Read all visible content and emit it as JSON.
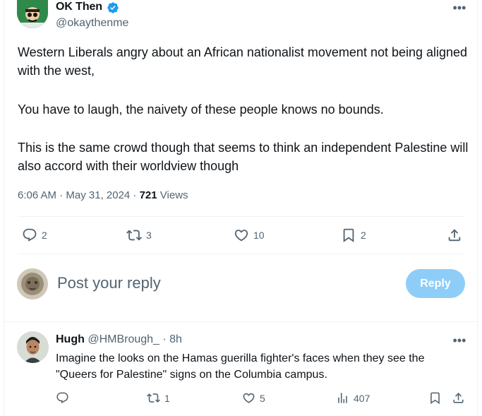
{
  "tweet": {
    "author_name": "OK Then",
    "author_handle": "@okaythenme",
    "paragraphs": [
      "Western Liberals angry about an African nationalist movement not being aligned with the west,",
      "You have to laugh, the naivety of these people knows no bounds.",
      "This is the same crowd though that seems to think an independent Palestine will also accord with their worldview though"
    ],
    "timestamp": "6:06 AM · May 31, 2024 · ",
    "views_count": "721",
    "views_label": " Views",
    "stats": {
      "replies": "2",
      "reposts": "3",
      "likes": "10",
      "bookmarks": "2"
    }
  },
  "reply_composer": {
    "placeholder": "Post your reply",
    "button_label": "Reply"
  },
  "reply": {
    "author_name": "Hugh",
    "author_handle": " @HMBrough_",
    "time": " · 8h",
    "text": "Imagine the looks on the Hamas guerilla fighter's faces when they see the \"Queers for Palestine\" signs on the Columbia campus.",
    "stats": {
      "replies": "",
      "reposts": "1",
      "likes": "5",
      "views": "407"
    }
  },
  "colors": {
    "text_primary": "#0f1419",
    "text_secondary": "#536471",
    "accent_blue": "#1d9bf0",
    "reply_button_disabled": "#8ecdf7",
    "divider": "#eff3f4"
  },
  "icons": [
    "more-icon",
    "verified-badge-icon",
    "reply-icon",
    "repost-icon",
    "like-icon",
    "bookmark-icon",
    "share-icon",
    "views-icon"
  ]
}
